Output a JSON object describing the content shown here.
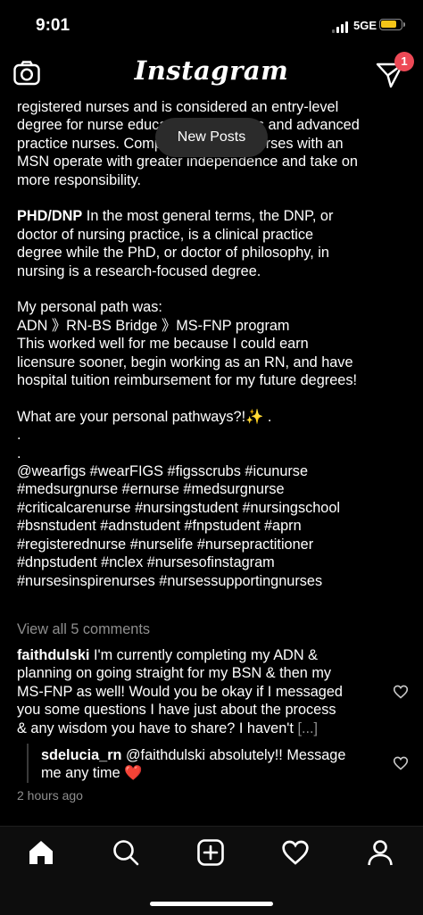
{
  "status_bar": {
    "time": "9:01",
    "network": "5GE",
    "battery_level": 0.85,
    "battery_color": "#f5c518"
  },
  "top_nav": {
    "left_icon": "camera-icon",
    "title": "Instagram",
    "right_icon": "direct-message-icon",
    "badge_count": "1",
    "badge_color": "#ed4956"
  },
  "caption": {
    "lines": [
      "registered nurses and is considered an entry-level",
      "degree for nurse educators, managers and advanced",
      "practice nurses. Compared to BSN, nurses with an",
      "MSN operate with greater independence and take on",
      "more responsibility."
    ],
    "phd_heading": "PHD/DNP",
    "phd_lines": [
      " In the most general terms, the DNP, or",
      "doctor of nursing practice, is a clinical practice",
      "degree while the PhD, or doctor of philosophy, in",
      "nursing is a research-focused degree."
    ],
    "path_lines": [
      "My personal path was:",
      "ADN 》RN-BS Bridge 》MS-FNP program",
      "This worked well for me because I could earn",
      "licensure sooner, begin working as an RN, and have",
      "hospital tuition reimbursement for my future degrees!"
    ],
    "question": "What are your personal pathways?!✨ .",
    "dots": [
      ".",
      "."
    ],
    "hashtags": [
      "@wearfigs #wearFIGS #figsscrubs #icunurse",
      "#medsurgnurse #ernurse #medsurgnurse",
      "#criticalcarenurse #nursingstudent #nursingschool",
      "#bsnstudent #adnstudent #fnpstudent #aprn",
      "#registerednurse #nurselife #nursepractitioner",
      "#dnpstudent #nclex #nursesofinstagram",
      "#nursesinspirenurses #nursessupportingnurses"
    ]
  },
  "new_posts_label": "New Posts",
  "view_all_comments": "View all 5 comments",
  "comments": [
    {
      "username": "faithdulski",
      "lines": [
        " I'm currently completing my ADN &",
        "planning on going straight for my BSN & then my",
        "MS-FNP as well! Would you be okay if I messaged",
        "you some questions I have just about the process",
        "& any wisdom you have to share? I haven't "
      ],
      "more": "[...]"
    },
    {
      "username": "sdelucia_rn",
      "lines": [
        " @faithdulski absolutely!! Message",
        "me any time ❤️"
      ]
    }
  ],
  "timestamp": "2 hours ago",
  "bottom_tabs": [
    "home-icon",
    "search-icon",
    "new-post-icon",
    "activity-heart-icon",
    "profile-icon"
  ]
}
